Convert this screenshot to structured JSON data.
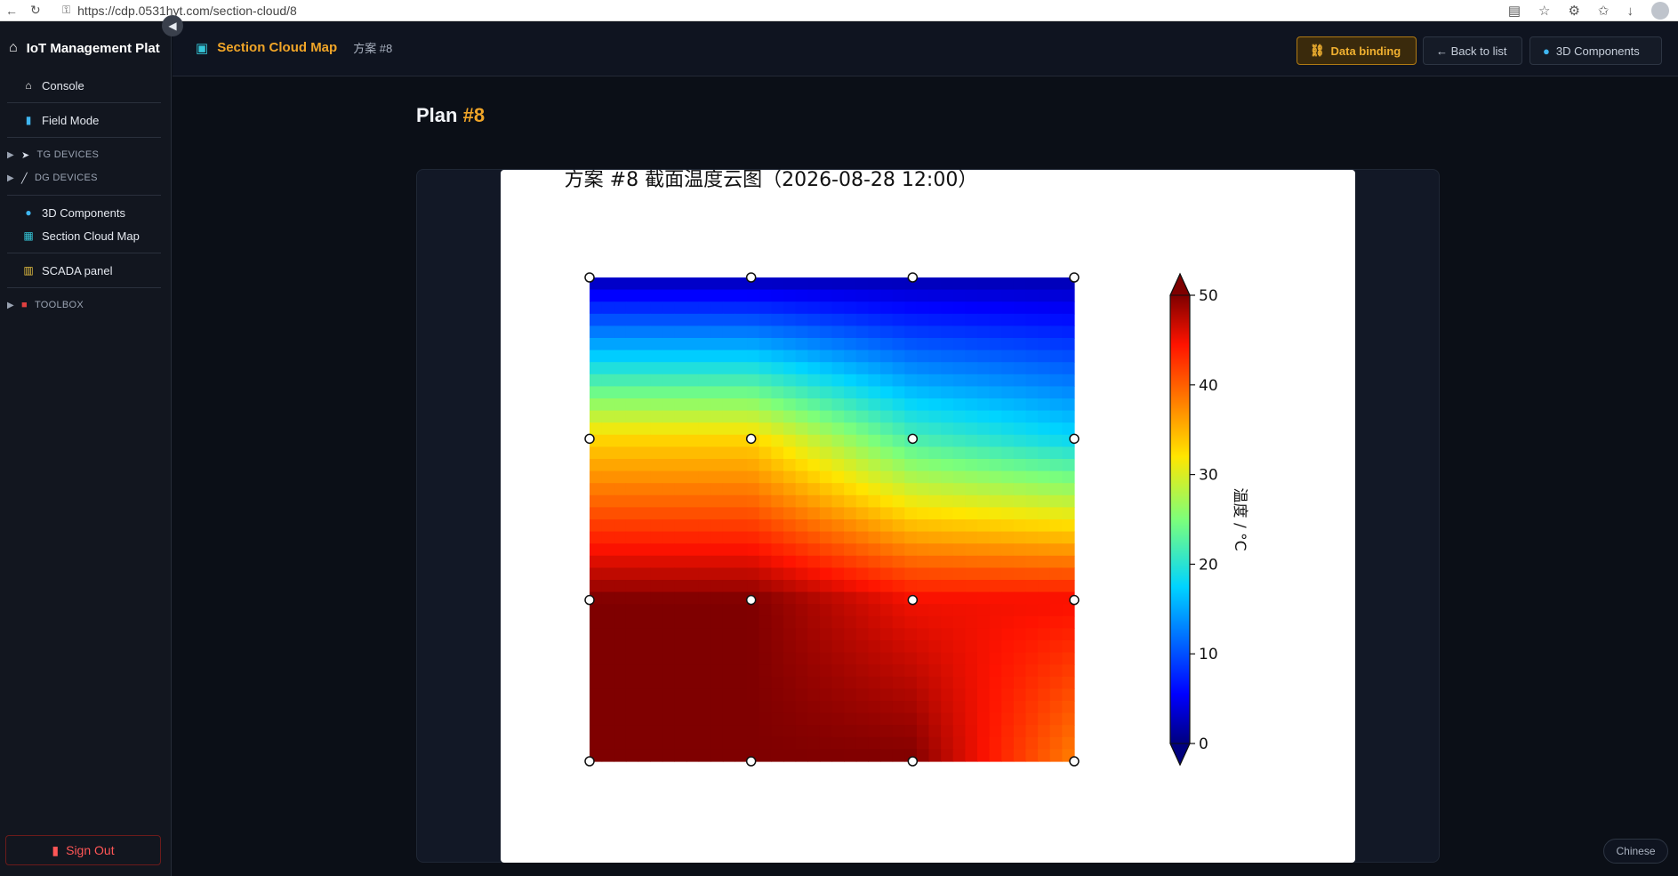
{
  "browser": {
    "url": "https://cdp.0531hyt.com/section-cloud/8"
  },
  "sidebar": {
    "brand": "IoT Management Plat",
    "collapse_icon": "chevron-left-icon",
    "items": [
      {
        "label": "Console",
        "icon": "home-icon"
      },
      {
        "label": "Field Mode",
        "icon": "phone-icon"
      }
    ],
    "groups": [
      {
        "label": "TG DEVICES"
      },
      {
        "label": "DG DEVICES"
      }
    ],
    "items2": [
      {
        "label": "3D Components",
        "icon": "globe-icon"
      },
      {
        "label": "Section Cloud Map",
        "icon": "map-icon"
      }
    ],
    "items3": [
      {
        "label": "SCADA panel",
        "icon": "bar-chart-icon"
      }
    ],
    "toolbox": {
      "label": "TOOLBOX"
    },
    "sign_out": "Sign Out"
  },
  "header": {
    "title": "Section Cloud Map",
    "subtitle": "方案 #8",
    "data_binding": "Data binding",
    "back_to_list": "← Back to list",
    "components_3d": "3D Components"
  },
  "main": {
    "plan_label": "Plan",
    "plan_number": "#8"
  },
  "language_button": "Chinese",
  "colors": {
    "accent": "#f0a528",
    "background": "#0b0f17",
    "sidebar": "#12161f",
    "signout": "#ff5656"
  },
  "chart_data": {
    "type": "heatmap",
    "title": "方案 #8  截面温度云图（2026-08-28 12:00）",
    "colorbar_label": "温度 / °C",
    "colormap": "jet",
    "vmin": 0,
    "vmax": 50,
    "colorbar_ticks": [
      0,
      10,
      20,
      30,
      40,
      50
    ],
    "x": [
      0,
      1,
      2,
      3
    ],
    "y": [
      0,
      1,
      2,
      3
    ],
    "values": [
      [
        50,
        50,
        50,
        38
      ],
      [
        50,
        50,
        45,
        45
      ],
      [
        33,
        33,
        22,
        18
      ],
      [
        2,
        2,
        2,
        2
      ]
    ],
    "grid": false
  }
}
